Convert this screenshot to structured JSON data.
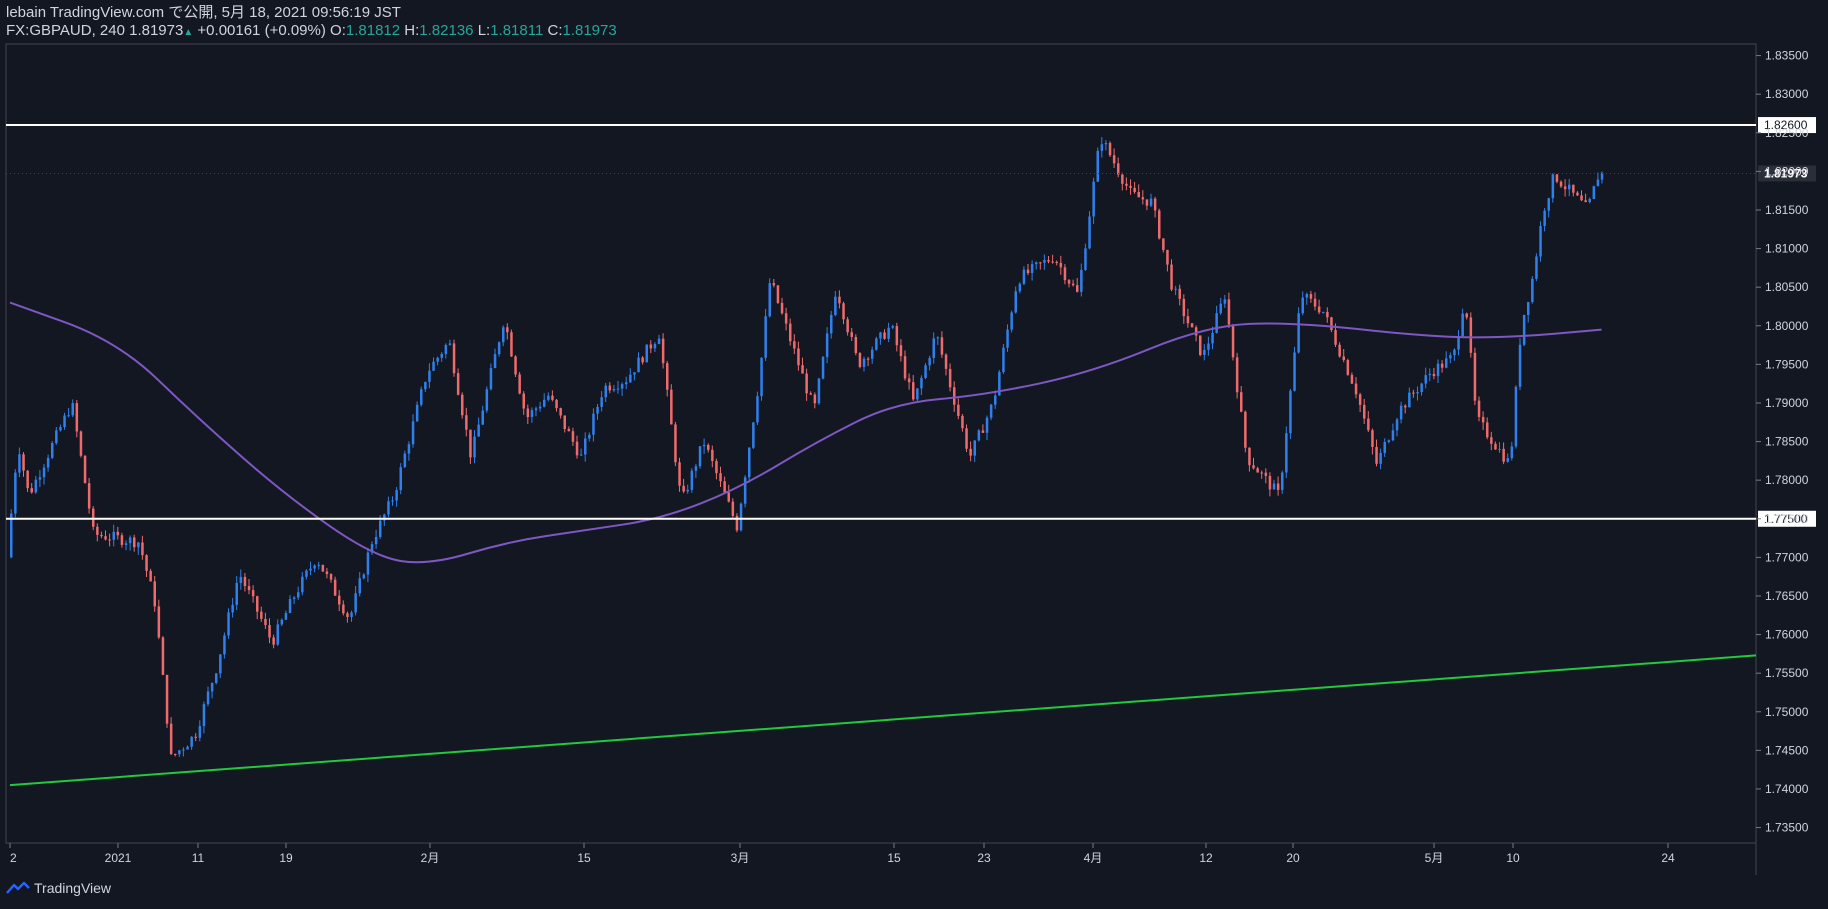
{
  "header": {
    "publish_line": "lebain TradingView.com で公開, 5月 18, 2021 09:56:19 JST",
    "symbol": "FX:GBPAUD, 240",
    "last": "1.81973",
    "change": "+0.00161 (+0.09%)",
    "o_label": "O:",
    "o_value": "1.81812",
    "h_label": "H:",
    "h_value": "1.82136",
    "l_label": "L:",
    "l_value": "1.81811",
    "c_label": "C:",
    "c_value": "1.81973"
  },
  "footer": {
    "brand": "TradingView"
  },
  "colors": {
    "background": "#131722",
    "up_candle": "#2f80ed",
    "down_candle": "#ef6b6b",
    "moving_average": "#7e57c2",
    "trendline": "#21c93d",
    "horizontal_levels": "#ffffff",
    "text": "#d1d4dc"
  },
  "chart_data": {
    "type": "candlestick",
    "symbol": "FX:GBPAUD",
    "timeframe": "240",
    "ylim": [
      1.733,
      1.8365
    ],
    "y_ticks": [
      "1.83500",
      "1.83000",
      "1.82500",
      "1.82000",
      "1.81500",
      "1.81000",
      "1.80500",
      "1.80000",
      "1.79500",
      "1.79000",
      "1.78500",
      "1.78000",
      "1.77500",
      "1.77000",
      "1.76500",
      "1.76000",
      "1.75500",
      "1.75000",
      "1.74500",
      "1.74000",
      "1.73500"
    ],
    "x_ticks": [
      {
        "label": "2",
        "date": "2020-12-22"
      },
      {
        "label": "2021",
        "date": "2021-01-01"
      },
      {
        "label": "11",
        "date": "2021-01-11"
      },
      {
        "label": "19",
        "date": "2021-01-19"
      },
      {
        "label": "2月",
        "date": "2021-02-01"
      },
      {
        "label": "15",
        "date": "2021-02-15"
      },
      {
        "label": "3月",
        "date": "2021-03-01"
      },
      {
        "label": "15",
        "date": "2021-03-15"
      },
      {
        "label": "23",
        "date": "2021-03-23"
      },
      {
        "label": "4月",
        "date": "2021-04-01"
      },
      {
        "label": "12",
        "date": "2021-04-12"
      },
      {
        "label": "20",
        "date": "2021-04-20"
      },
      {
        "label": "5月",
        "date": "2021-05-03"
      },
      {
        "label": "10",
        "date": "2021-05-10"
      },
      {
        "label": "24",
        "date": "2021-05-24"
      }
    ],
    "price_path": [
      {
        "date": "2020-12-22",
        "price": 1.77
      },
      {
        "date": "2020-12-23",
        "price": 1.785
      },
      {
        "date": "2020-12-24",
        "price": 1.778
      },
      {
        "date": "2020-12-28",
        "price": 1.79
      },
      {
        "date": "2020-12-30",
        "price": 1.773
      },
      {
        "date": "2021-01-04",
        "price": 1.772
      },
      {
        "date": "2021-01-06",
        "price": 1.764
      },
      {
        "date": "2021-01-08",
        "price": 1.744
      },
      {
        "date": "2021-01-11",
        "price": 1.747
      },
      {
        "date": "2021-01-13",
        "price": 1.756
      },
      {
        "date": "2021-01-15",
        "price": 1.768
      },
      {
        "date": "2021-01-18",
        "price": 1.759
      },
      {
        "date": "2021-01-20",
        "price": 1.765
      },
      {
        "date": "2021-01-22",
        "price": 1.77
      },
      {
        "date": "2021-01-25",
        "price": 1.762
      },
      {
        "date": "2021-01-27",
        "price": 1.772
      },
      {
        "date": "2021-01-29",
        "price": 1.778
      },
      {
        "date": "2021-02-01",
        "price": 1.794
      },
      {
        "date": "2021-02-03",
        "price": 1.798
      },
      {
        "date": "2021-02-05",
        "price": 1.783
      },
      {
        "date": "2021-02-08",
        "price": 1.801
      },
      {
        "date": "2021-02-10",
        "price": 1.788
      },
      {
        "date": "2021-02-12",
        "price": 1.791
      },
      {
        "date": "2021-02-15",
        "price": 1.783
      },
      {
        "date": "2021-02-17",
        "price": 1.792
      },
      {
        "date": "2021-02-19",
        "price": 1.793
      },
      {
        "date": "2021-02-22",
        "price": 1.799
      },
      {
        "date": "2021-02-24",
        "price": 1.777
      },
      {
        "date": "2021-02-26",
        "price": 1.785
      },
      {
        "date": "2021-03-01",
        "price": 1.774
      },
      {
        "date": "2021-03-03",
        "price": 1.793
      },
      {
        "date": "2021-03-04",
        "price": 1.806
      },
      {
        "date": "2021-03-08",
        "price": 1.789
      },
      {
        "date": "2021-03-10",
        "price": 1.805
      },
      {
        "date": "2021-03-12",
        "price": 1.795
      },
      {
        "date": "2021-03-15",
        "price": 1.8
      },
      {
        "date": "2021-03-17",
        "price": 1.79
      },
      {
        "date": "2021-03-19",
        "price": 1.799
      },
      {
        "date": "2021-03-22",
        "price": 1.783
      },
      {
        "date": "2021-03-24",
        "price": 1.79
      },
      {
        "date": "2021-03-26",
        "price": 1.806
      },
      {
        "date": "2021-03-29",
        "price": 1.809
      },
      {
        "date": "2021-03-31",
        "price": 1.804
      },
      {
        "date": "2021-04-02",
        "price": 1.8245
      },
      {
        "date": "2021-04-05",
        "price": 1.817
      },
      {
        "date": "2021-04-07",
        "price": 1.816
      },
      {
        "date": "2021-04-09",
        "price": 1.805
      },
      {
        "date": "2021-04-12",
        "price": 1.796
      },
      {
        "date": "2021-04-14",
        "price": 1.804
      },
      {
        "date": "2021-04-16",
        "price": 1.783
      },
      {
        "date": "2021-04-19",
        "price": 1.778
      },
      {
        "date": "2021-04-21",
        "price": 1.804
      },
      {
        "date": "2021-04-23",
        "price": 1.802
      },
      {
        "date": "2021-04-26",
        "price": 1.792
      },
      {
        "date": "2021-04-28",
        "price": 1.782
      },
      {
        "date": "2021-04-30",
        "price": 1.789
      },
      {
        "date": "2021-05-03",
        "price": 1.794
      },
      {
        "date": "2021-05-05",
        "price": 1.796
      },
      {
        "date": "2021-05-06",
        "price": 1.804
      },
      {
        "date": "2021-05-07",
        "price": 1.788
      },
      {
        "date": "2021-05-10",
        "price": 1.782
      },
      {
        "date": "2021-05-11",
        "price": 1.8
      },
      {
        "date": "2021-05-12",
        "price": 1.806
      },
      {
        "date": "2021-05-13",
        "price": 1.815
      },
      {
        "date": "2021-05-14",
        "price": 1.8195
      },
      {
        "date": "2021-05-17",
        "price": 1.815
      },
      {
        "date": "2021-05-18",
        "price": 1.8197
      }
    ],
    "moving_average": [
      {
        "date": "2020-12-22",
        "value": 1.803
      },
      {
        "date": "2021-01-01",
        "value": 1.798
      },
      {
        "date": "2021-01-11",
        "value": 1.788
      },
      {
        "date": "2021-01-19",
        "value": 1.778
      },
      {
        "date": "2021-01-27",
        "value": 1.77
      },
      {
        "date": "2021-02-01",
        "value": 1.769
      },
      {
        "date": "2021-02-08",
        "value": 1.772
      },
      {
        "date": "2021-02-15",
        "value": 1.7735
      },
      {
        "date": "2021-02-22",
        "value": 1.775
      },
      {
        "date": "2021-03-01",
        "value": 1.779
      },
      {
        "date": "2021-03-08",
        "value": 1.785
      },
      {
        "date": "2021-03-15",
        "value": 1.79
      },
      {
        "date": "2021-03-23",
        "value": 1.791
      },
      {
        "date": "2021-04-01",
        "value": 1.794
      },
      {
        "date": "2021-04-12",
        "value": 1.8
      },
      {
        "date": "2021-04-20",
        "value": 1.8005
      },
      {
        "date": "2021-05-03",
        "value": 1.7985
      },
      {
        "date": "2021-05-10",
        "value": 1.7985
      },
      {
        "date": "2021-05-18",
        "value": 1.7995
      }
    ],
    "horizontal_levels": [
      {
        "label": "1.82600",
        "value": 1.826
      },
      {
        "label": "1.77500",
        "value": 1.775
      }
    ],
    "trendline": {
      "start": {
        "date": "2020-12-22",
        "value": 1.7405
      },
      "end": {
        "date": "2021-05-29",
        "value": 1.7573
      }
    },
    "last_price": {
      "label": "1.81973",
      "value": 1.81973
    }
  }
}
